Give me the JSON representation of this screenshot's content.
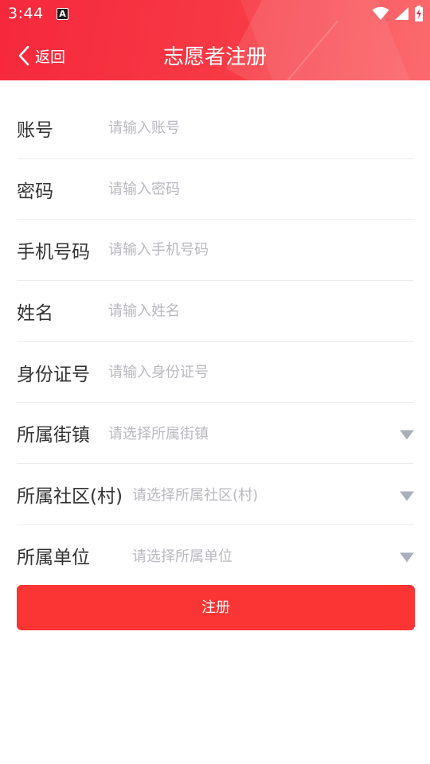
{
  "status_bar": {
    "time": "3:44",
    "app_icon_letter": "A"
  },
  "nav": {
    "back_label": "返回",
    "title": "志愿者注册"
  },
  "colors": {
    "primary": "#f6283c",
    "button": "#fb3434",
    "placeholder": "#b8b8bf",
    "label": "#333333"
  },
  "form": {
    "fields": [
      {
        "label": "账号",
        "placeholder": "请输入账号"
      },
      {
        "label": "密码",
        "placeholder": "请输入密码"
      },
      {
        "label": "手机号码",
        "placeholder": "请输入手机号码"
      },
      {
        "label": "姓名",
        "placeholder": "请输入姓名"
      },
      {
        "label": "身份证号",
        "placeholder": "请输入身份证号"
      }
    ],
    "selects": [
      {
        "label": "所属街镇",
        "placeholder": "请选择所属街镇",
        "icon": "dropdown-triangle-icon"
      },
      {
        "label": "所属社区(村)",
        "placeholder": "请选择所属社区(村)",
        "icon": "dropdown-triangle-icon"
      },
      {
        "label": "所属单位",
        "placeholder": "请选择所属单位",
        "icon": "dropdown-triangle-icon"
      }
    ]
  },
  "submit_label": "注册"
}
